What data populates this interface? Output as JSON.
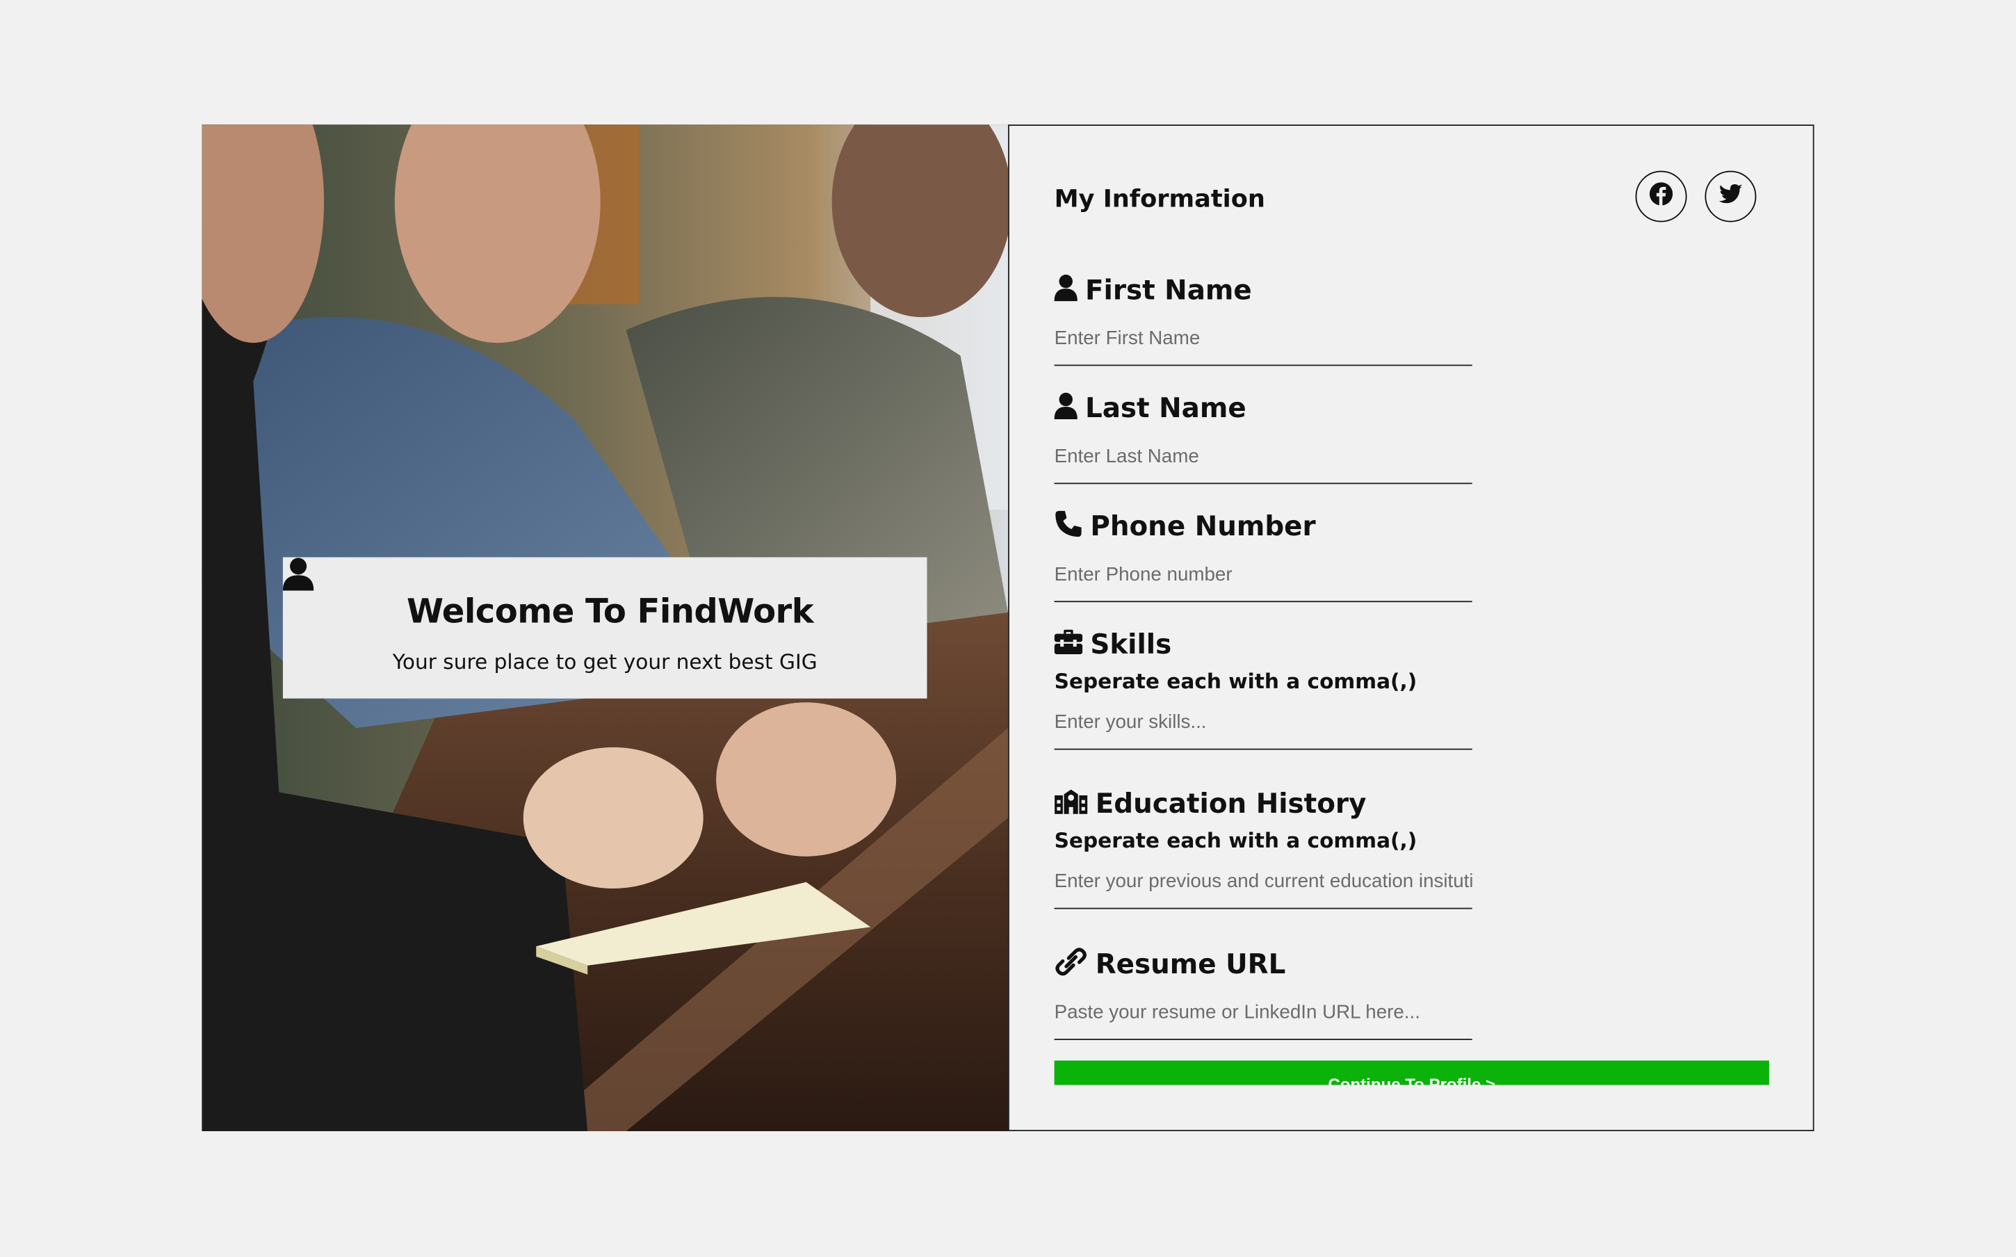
{
  "welcome": {
    "title": "Welcome To FindWork",
    "subtitle": "Your sure place to get your next best GIG"
  },
  "form": {
    "title": "My Information",
    "social": [
      {
        "icon": "facebook-icon"
      },
      {
        "icon": "twitter-icon"
      }
    ],
    "fields": {
      "first_name": {
        "label": "First Name",
        "icon": "user-icon",
        "placeholder": "Enter First Name",
        "value": ""
      },
      "last_name": {
        "label": "Last Name",
        "icon": "user-icon",
        "placeholder": "Enter Last Name",
        "value": ""
      },
      "phone": {
        "label": "Phone Number",
        "icon": "phone-icon",
        "placeholder": "Enter Phone number",
        "value": ""
      },
      "skills": {
        "label": "Skills",
        "icon": "toolbox-icon",
        "hint": "Seperate each with a comma(,)",
        "placeholder": "Enter your skills...",
        "value": ""
      },
      "education": {
        "label": "Education History",
        "icon": "school-icon",
        "hint": "Seperate each with a comma(,)",
        "placeholder": "Enter your previous and current education insitutions...",
        "value": ""
      },
      "resume": {
        "label": "Resume URL",
        "icon": "link-icon",
        "placeholder": "Paste your resume or LinkedIn URL here...",
        "value": ""
      }
    },
    "continue_label": "Continue To Profile >",
    "accent_color": "#0ab20a"
  }
}
